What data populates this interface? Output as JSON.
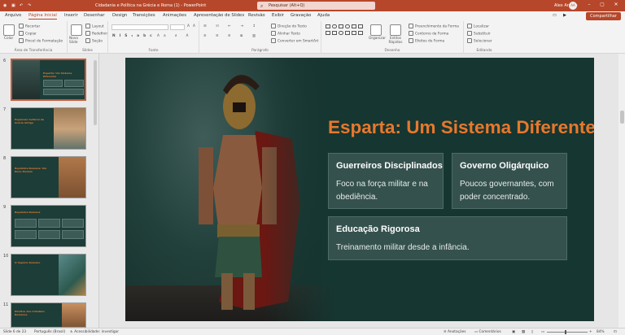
{
  "titlebar": {
    "document_title": "Cidadania e Política na Grécia e Roma (1)  -  PowerPoint",
    "search_placeholder": "Pesquisar (Alt+Q)",
    "user_name": "Alex Araujo",
    "user_initials": "AA"
  },
  "tabs": [
    "Arquivo",
    "Página Inicial",
    "Inserir",
    "Desenhar",
    "Design",
    "Transições",
    "Animações",
    "Apresentação de Slides",
    "Revisão",
    "Exibir",
    "Gravação",
    "Ajuda"
  ],
  "share_label": "Compartilhar",
  "ribbon": {
    "clipboard": {
      "paste": "Colar",
      "cut": "Recortar",
      "copy": "Copiar",
      "format_painter": "Pincel de Formatação",
      "label": "Área de Transferência"
    },
    "slides": {
      "new_slide": "Novo Slide",
      "layout": "Layout",
      "reset": "Redefinir",
      "section": "Seção",
      "label": "Slides"
    },
    "font": {
      "label": "Fonte"
    },
    "paragraph": {
      "text_direction": "Direção do Texto",
      "align_text": "Alinhar Texto",
      "smartart": "Converter em SmartArt",
      "label": "Parágrafo"
    },
    "drawing": {
      "arrange": "Organizar",
      "quick_styles": "Estilos Rápidos",
      "shape_fill": "Preenchimento da Forma",
      "shape_outline": "Contorno da Forma",
      "shape_effects": "Efeitos de Forma",
      "label": "Desenho"
    },
    "editing": {
      "find": "Localizar",
      "replace": "Substituir",
      "select": "Selecionar",
      "label": "Editando"
    }
  },
  "thumbnails": [
    {
      "num": "6",
      "title": "Esparta: Um Sistema Diferente",
      "selected": true
    },
    {
      "num": "7",
      "title": "Expansão Cultural da Grécia Antiga",
      "selected": false
    },
    {
      "num": "8",
      "title": "República Romana: Um Novo Modelo",
      "selected": false
    },
    {
      "num": "9",
      "title": "República Romana",
      "selected": false
    },
    {
      "num": "10",
      "title": "O Império Romano",
      "selected": false
    },
    {
      "num": "11",
      "title": "Direitos dos Cidadãos Romanos",
      "selected": false
    }
  ],
  "slide": {
    "title": "Esparta: Um Sistema Diferente",
    "cards": [
      {
        "heading": "Guerreiros Disciplinados",
        "body": "Foco na força militar e na obediência."
      },
      {
        "heading": "Governo Oligárquico",
        "body": "Poucos governantes, com poder concentrado."
      },
      {
        "heading": "Educação Rigorosa",
        "body": "Treinamento militar desde a infância."
      }
    ]
  },
  "status": {
    "slide_info": "Slide 6 de 23",
    "language": "Português (Brasil)",
    "accessibility": "Acessibilidade: investigar",
    "notes": "Anotações",
    "comments": "Comentários",
    "zoom": "84%"
  },
  "colors": {
    "accent": "#b7472a",
    "slide_bg": "#163631",
    "title_orange": "#e8782c",
    "card_bg": "#35514d"
  }
}
